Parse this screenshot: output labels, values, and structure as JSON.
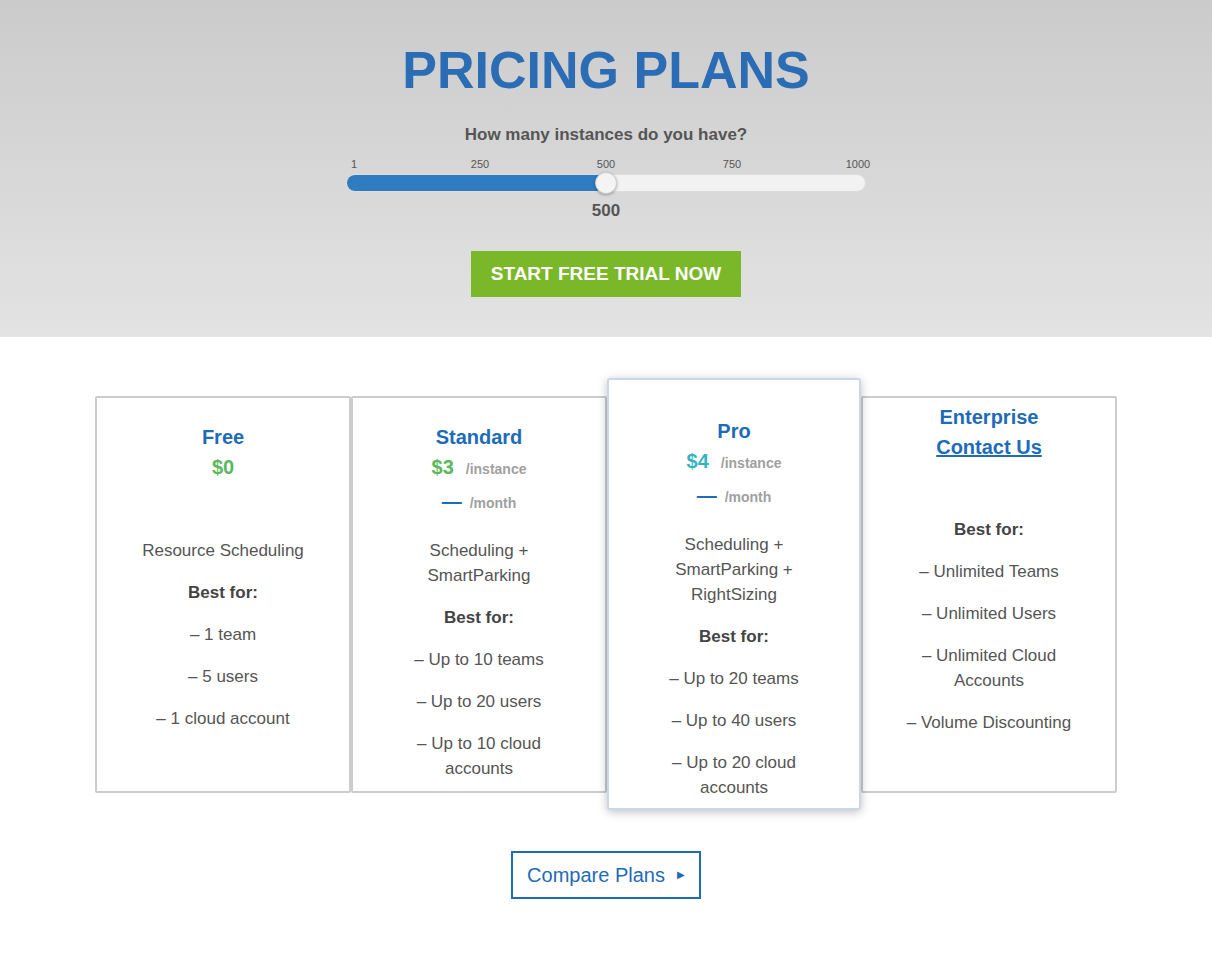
{
  "hero": {
    "title": "PRICING PLANS",
    "question": "How many instances do you have?",
    "slider": {
      "ticks": [
        "1",
        "250",
        "500",
        "750",
        "1000"
      ],
      "level": 0.5,
      "value": "500"
    },
    "cta": "START FREE TRIAL NOW"
  },
  "plans": [
    {
      "kind": "free",
      "selected": false,
      "name": "Free",
      "price": "$0",
      "features": "Resource Scheduling",
      "best_for": "Best for:",
      "items": [
        "– 1 team",
        "– 5 users",
        "– 1 cloud account"
      ]
    },
    {
      "kind": "paid",
      "selected": false,
      "name": "Standard",
      "price": "$3",
      "unit": "/instance",
      "dash": "—",
      "period": "/month",
      "features": "Scheduling + SmartParking",
      "best_for": "Best for:",
      "items": [
        "– Up to 10 teams",
        "– Up to 20 users",
        "– Up to 10 cloud accounts"
      ]
    },
    {
      "kind": "paid",
      "selected": true,
      "name": "Pro",
      "price": "$4",
      "unit": "/instance",
      "dash": "—",
      "period": "/month",
      "features": "Scheduling + SmartParking + RightSizing",
      "best_for": "Best for:",
      "items": [
        "– Up to 20 teams",
        "– Up to 40 users",
        "– Up to 20 cloud accounts"
      ]
    },
    {
      "kind": "contact",
      "selected": false,
      "name": "Enterprise",
      "link": "Contact Us",
      "best_for": "Best for:",
      "items": [
        "– Unlimited Teams",
        "– Unlimited Users",
        "– Unlimited Cloud Accounts",
        "– Volume Discounting"
      ]
    }
  ],
  "compare": {
    "label": "Compare Plans",
    "icon": "▶"
  }
}
